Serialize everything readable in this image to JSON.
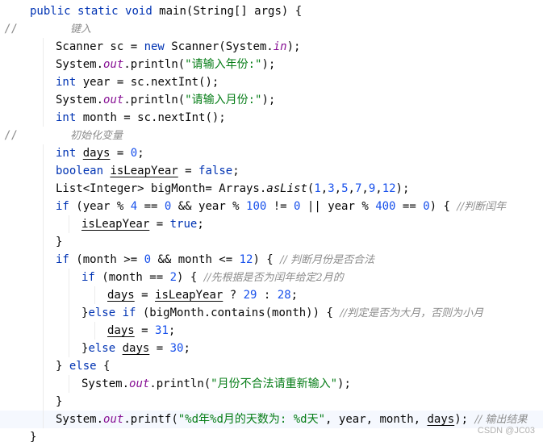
{
  "editor": {
    "line_comment_marker": "//",
    "lines": [
      {
        "segments": [
          {
            "t": "public",
            "c": "kw"
          },
          {
            "t": " "
          },
          {
            "t": "static",
            "c": "kw"
          },
          {
            "t": " "
          },
          {
            "t": "void",
            "c": "kw"
          },
          {
            "t": " main(String[] args) {"
          }
        ]
      },
      {
        "segments": [
          {
            "t": "键入",
            "c": "cm"
          }
        ]
      },
      {
        "segments": [
          {
            "t": "Scanner sc = "
          },
          {
            "t": "new",
            "c": "kw"
          },
          {
            "t": " Scanner(System."
          },
          {
            "t": "in",
            "c": "static-field"
          },
          {
            "t": ");"
          }
        ]
      },
      {
        "segments": [
          {
            "t": "System."
          },
          {
            "t": "out",
            "c": "static-field"
          },
          {
            "t": ".println("
          },
          {
            "t": "\"请输入年份:\"",
            "c": "str"
          },
          {
            "t": ");"
          }
        ]
      },
      {
        "segments": [
          {
            "t": "int",
            "c": "kw"
          },
          {
            "t": " year = sc.nextInt();"
          }
        ]
      },
      {
        "segments": [
          {
            "t": "System."
          },
          {
            "t": "out",
            "c": "static-field"
          },
          {
            "t": ".println("
          },
          {
            "t": "\"请输入月份:\"",
            "c": "str"
          },
          {
            "t": ");"
          }
        ]
      },
      {
        "segments": [
          {
            "t": "int",
            "c": "kw"
          },
          {
            "t": " month = sc.nextInt();"
          }
        ]
      },
      {
        "segments": [
          {
            "t": "初始化变量",
            "c": "cm"
          }
        ]
      },
      {
        "segments": [
          {
            "t": "int",
            "c": "kw"
          },
          {
            "t": " "
          },
          {
            "t": "days",
            "c": "ul"
          },
          {
            "t": " = "
          },
          {
            "t": "0",
            "c": "num"
          },
          {
            "t": ";"
          }
        ]
      },
      {
        "segments": [
          {
            "t": "boolean",
            "c": "kw"
          },
          {
            "t": " "
          },
          {
            "t": "isLeapYear",
            "c": "ul"
          },
          {
            "t": " = "
          },
          {
            "t": "false",
            "c": "kw"
          },
          {
            "t": ";"
          }
        ]
      },
      {
        "segments": [
          {
            "t": "List<Integer> bigMonth= Arrays."
          },
          {
            "t": "asList",
            "c": "static-method"
          },
          {
            "t": "("
          },
          {
            "t": "1",
            "c": "num"
          },
          {
            "t": ","
          },
          {
            "t": "3",
            "c": "num"
          },
          {
            "t": ","
          },
          {
            "t": "5",
            "c": "num"
          },
          {
            "t": ","
          },
          {
            "t": "7",
            "c": "num"
          },
          {
            "t": ","
          },
          {
            "t": "9",
            "c": "num"
          },
          {
            "t": ","
          },
          {
            "t": "12",
            "c": "num"
          },
          {
            "t": ");"
          }
        ]
      },
      {
        "segments": [
          {
            "t": "if",
            "c": "kw"
          },
          {
            "t": " (year % "
          },
          {
            "t": "4",
            "c": "num"
          },
          {
            "t": " == "
          },
          {
            "t": "0",
            "c": "num"
          },
          {
            "t": " && year % "
          },
          {
            "t": "100",
            "c": "num"
          },
          {
            "t": " != "
          },
          {
            "t": "0",
            "c": "num"
          },
          {
            "t": " || year % "
          },
          {
            "t": "400",
            "c": "num"
          },
          {
            "t": " == "
          },
          {
            "t": "0",
            "c": "num"
          },
          {
            "t": ") { "
          },
          {
            "t": "//判断闰年",
            "c": "cm"
          }
        ]
      },
      {
        "segments": [
          {
            "t": "isLeapYear",
            "c": "ul"
          },
          {
            "t": " = "
          },
          {
            "t": "true",
            "c": "kw"
          },
          {
            "t": ";"
          }
        ]
      },
      {
        "segments": [
          {
            "t": "}"
          }
        ]
      },
      {
        "segments": [
          {
            "t": "if",
            "c": "kw"
          },
          {
            "t": " (month >= "
          },
          {
            "t": "0",
            "c": "num"
          },
          {
            "t": " && month <= "
          },
          {
            "t": "12",
            "c": "num"
          },
          {
            "t": ") { "
          },
          {
            "t": "// 判断月份是否合法",
            "c": "cm"
          }
        ]
      },
      {
        "segments": [
          {
            "t": "if",
            "c": "kw"
          },
          {
            "t": " (month == "
          },
          {
            "t": "2",
            "c": "num"
          },
          {
            "t": ") { "
          },
          {
            "t": "//先根据是否为闰年给定2月的",
            "c": "cm"
          }
        ]
      },
      {
        "segments": [
          {
            "t": "days",
            "c": "ul"
          },
          {
            "t": " = "
          },
          {
            "t": "isLeapYear",
            "c": "ul"
          },
          {
            "t": " ? "
          },
          {
            "t": "29",
            "c": "num"
          },
          {
            "t": " : "
          },
          {
            "t": "28",
            "c": "num"
          },
          {
            "t": ";"
          }
        ]
      },
      {
        "segments": [
          {
            "t": "}"
          },
          {
            "t": "else",
            "c": "kw"
          },
          {
            "t": " "
          },
          {
            "t": "if",
            "c": "kw"
          },
          {
            "t": " (bigMonth.contains(month)) { "
          },
          {
            "t": "//判定是否为大月，否则为小月",
            "c": "cm"
          }
        ]
      },
      {
        "segments": [
          {
            "t": "days",
            "c": "ul"
          },
          {
            "t": " = "
          },
          {
            "t": "31",
            "c": "num"
          },
          {
            "t": ";"
          }
        ]
      },
      {
        "segments": [
          {
            "t": "}"
          },
          {
            "t": "else",
            "c": "kw"
          },
          {
            "t": " "
          },
          {
            "t": "days",
            "c": "ul"
          },
          {
            "t": " = "
          },
          {
            "t": "30",
            "c": "num"
          },
          {
            "t": ";"
          }
        ]
      },
      {
        "segments": [
          {
            "t": "} "
          },
          {
            "t": "else",
            "c": "kw"
          },
          {
            "t": " {"
          }
        ]
      },
      {
        "segments": [
          {
            "t": "System."
          },
          {
            "t": "out",
            "c": "static-field"
          },
          {
            "t": ".println("
          },
          {
            "t": "\"月份不合法请重新输入\"",
            "c": "str"
          },
          {
            "t": ");"
          }
        ]
      },
      {
        "segments": [
          {
            "t": "}"
          }
        ]
      },
      {
        "segments": [
          {
            "t": "System."
          },
          {
            "t": "out",
            "c": "static-field"
          },
          {
            "t": ".printf("
          },
          {
            "t": "\"%d年%d月的天数为: %d天\"",
            "c": "str"
          },
          {
            "t": ", year, month, "
          },
          {
            "t": "days",
            "c": "ul"
          },
          {
            "t": "); "
          },
          {
            "t": "// 输出结果",
            "c": "cm"
          }
        ]
      },
      {
        "segments": [
          {
            "t": "}"
          }
        ]
      }
    ]
  },
  "watermark": "CSDN @JC03"
}
